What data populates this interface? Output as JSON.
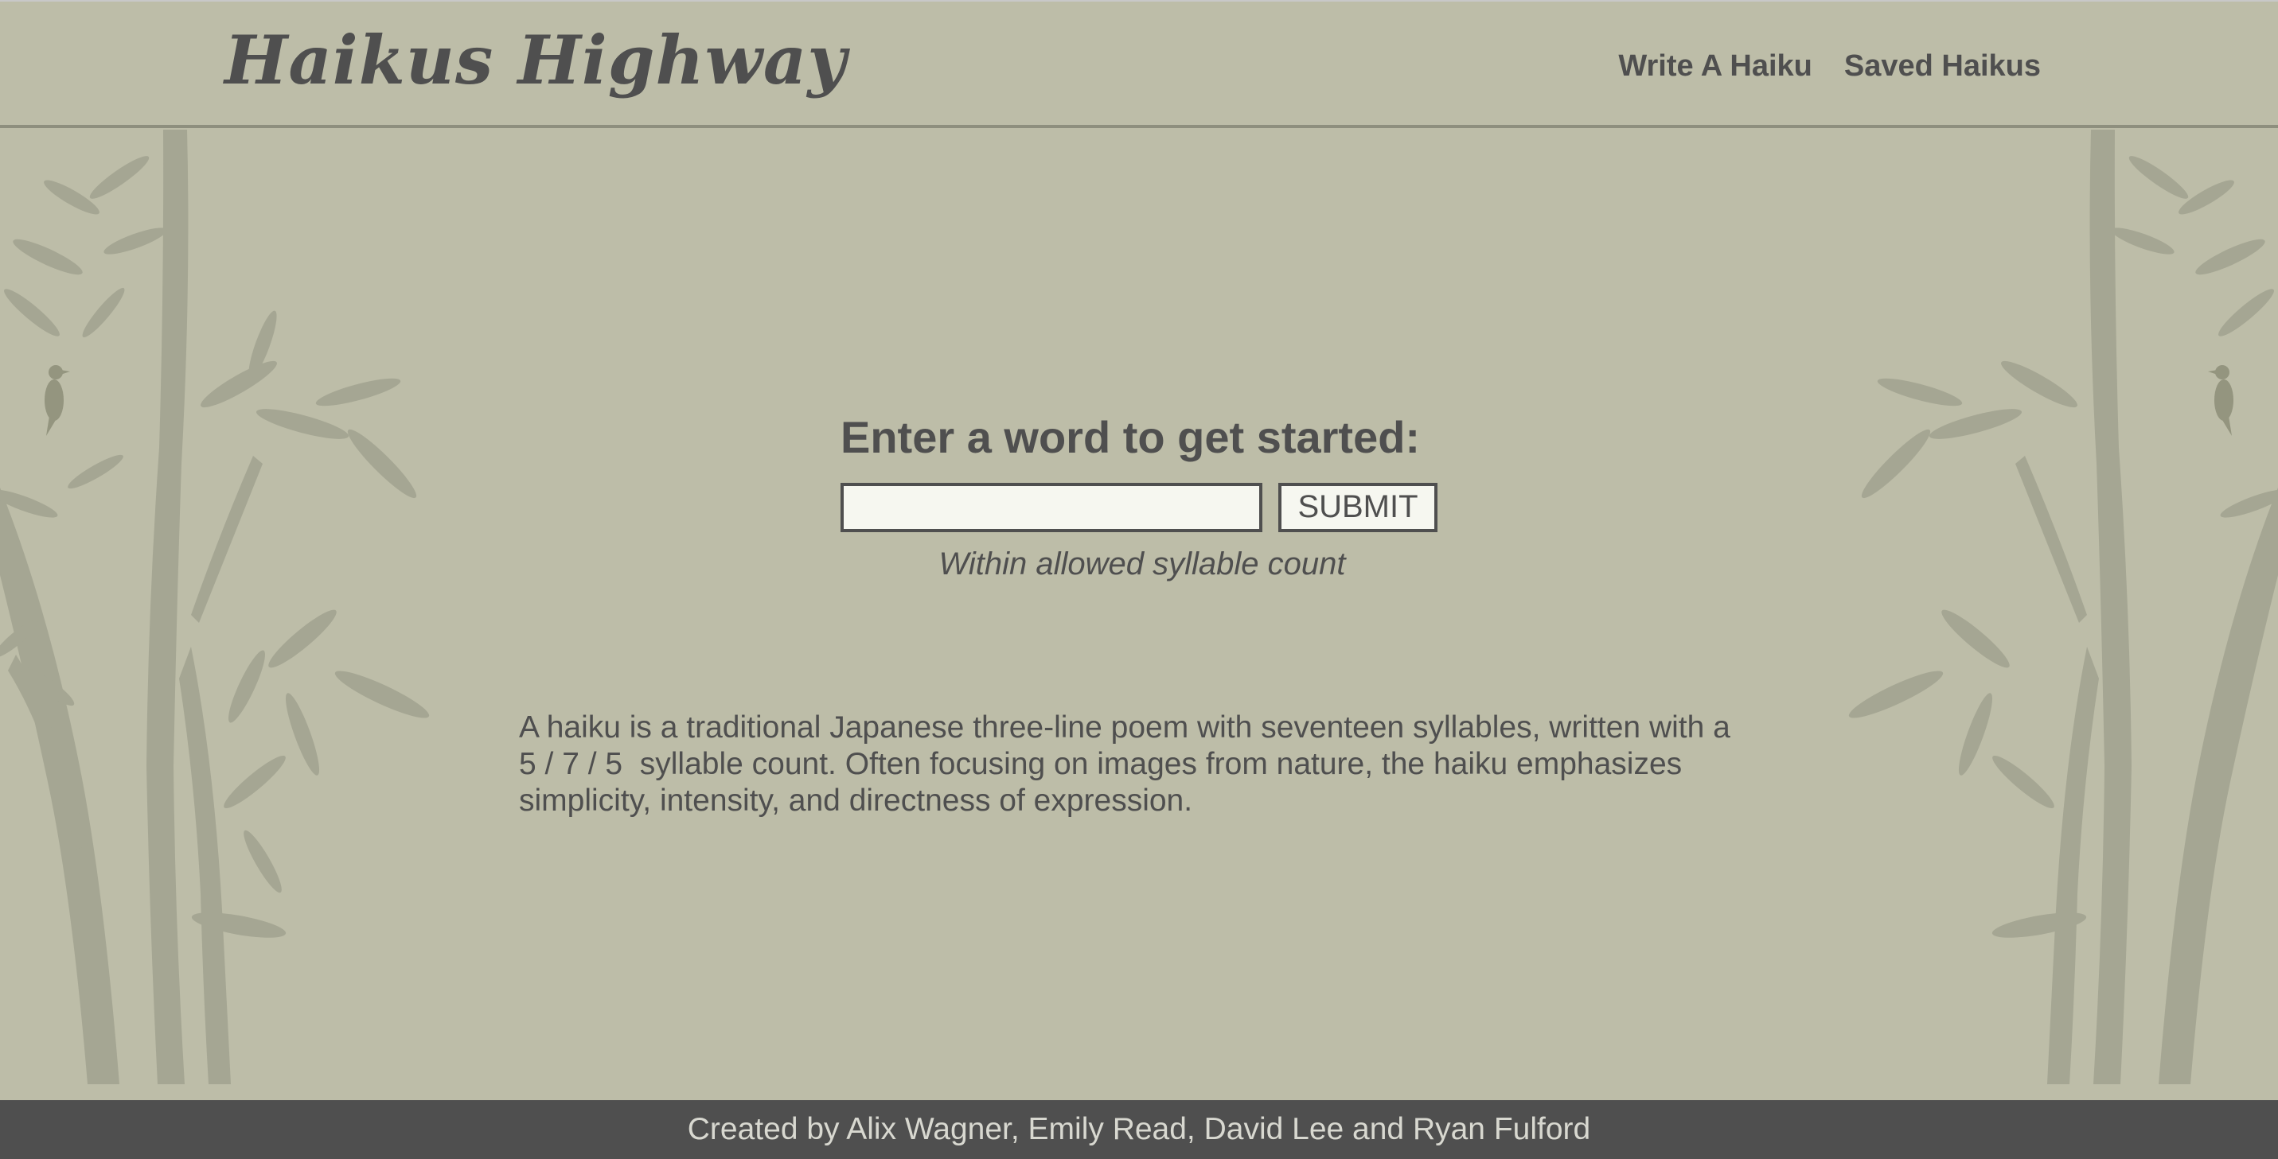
{
  "header": {
    "brand": "Haikus Highway",
    "nav": [
      {
        "label": "Write A Haiku"
      },
      {
        "label": "Saved Haikus"
      }
    ]
  },
  "main": {
    "prompt": "Enter a word to get started:",
    "word_input": {
      "value": "",
      "placeholder": ""
    },
    "submit_label": "SUBMIT",
    "syllable_note": "Within allowed syllable count",
    "description_lines": [
      "A haiku is a traditional Japanese three-line poem with seventeen syllables, written with a",
      "5 / 7 / 5  syllable count. Often focusing on images from nature, the haiku emphasizes",
      "simplicity, intensity, and directness of expression."
    ]
  },
  "footer": {
    "credits": "Created by Alix Wagner, Emily Read, David Lee and Ryan Fulford"
  },
  "colors": {
    "background": "#bdbda8",
    "text": "#4f4f4f",
    "footer_bg": "#4f4f4f",
    "bamboo": "#a5a693"
  },
  "icons": [
    "bamboo-left-illustration",
    "bamboo-right-illustration",
    "bird-icon"
  ]
}
